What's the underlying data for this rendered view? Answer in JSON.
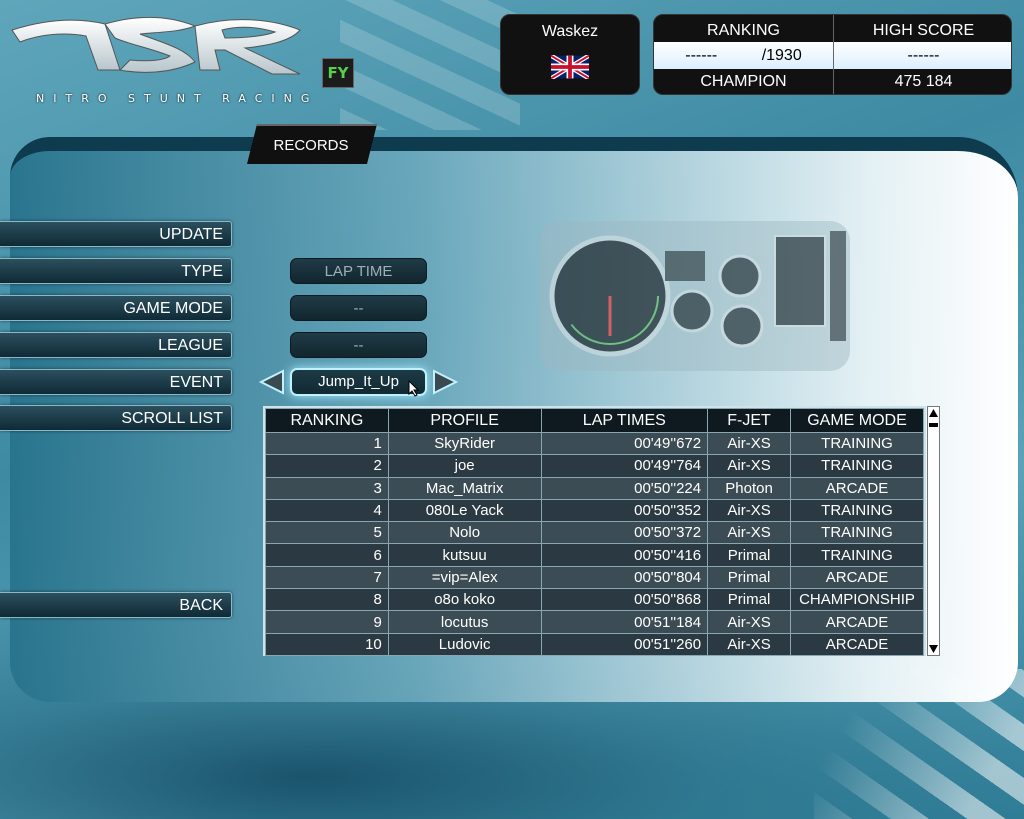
{
  "logo": {
    "subtitle": "NITRO STUNT RACING",
    "badge": "FY"
  },
  "player": {
    "name": "Waskez",
    "flag": "uk-flag-icon"
  },
  "score": {
    "ranking_label": "RANKING",
    "high_score_label": "HIGH SCORE",
    "ranking_value": "------          /1930",
    "high_score_value": "------",
    "title": "CHAMPION",
    "title_score": "475 184"
  },
  "tab": {
    "label": "RECORDS"
  },
  "menu": {
    "update": "UPDATE",
    "type": "TYPE",
    "game_mode": "GAME MODE",
    "league": "LEAGUE",
    "event": "EVENT",
    "scroll_list": "SCROLL LIST",
    "back": "BACK"
  },
  "filters": {
    "type": "LAP TIME",
    "game_mode": "--",
    "league": "--",
    "event": "Jump_It_Up"
  },
  "table": {
    "headers": [
      "RANKING",
      "PROFILE",
      "LAP TIMES",
      "F-JET",
      "GAME MODE"
    ],
    "rows": [
      [
        "1",
        "SkyRider",
        "00'49''672",
        "Air-XS",
        "TRAINING"
      ],
      [
        "2",
        "joe",
        "00'49''764",
        "Air-XS",
        "TRAINING"
      ],
      [
        "3",
        "Mac_Matrix",
        "00'50''224",
        "Photon",
        "ARCADE"
      ],
      [
        "4",
        "080Le Yack",
        "00'50''352",
        "Air-XS",
        "TRAINING"
      ],
      [
        "5",
        "Nolo",
        "00'50''372",
        "Air-XS",
        "TRAINING"
      ],
      [
        "6",
        "kutsuu",
        "00'50''416",
        "Primal",
        "TRAINING"
      ],
      [
        "7",
        "=vip=Alex",
        "00'50''804",
        "Primal",
        "ARCADE"
      ],
      [
        "8",
        "o8o koko",
        "00'50''868",
        "Primal",
        "CHAMPIONSHIP"
      ],
      [
        "9",
        "locutus",
        "00'51''184",
        "Air-XS",
        "ARCADE"
      ],
      [
        "10",
        "Ludovic",
        "00'51''260",
        "Air-XS",
        "ARCADE"
      ]
    ]
  }
}
